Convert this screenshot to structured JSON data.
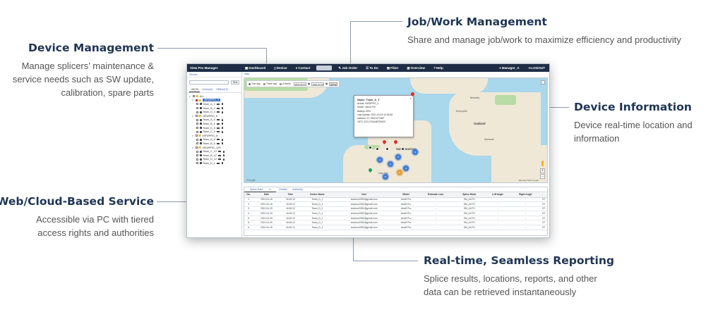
{
  "callouts": {
    "device_management": {
      "title": "Device Management",
      "text": "Manage splicers’ maintenance & service needs such as SW update, calibration, spare parts"
    },
    "job_management": {
      "title": "Job/Work Management",
      "text": "Share and manage job/work to maximize efficiency and productivity"
    },
    "device_information": {
      "title": "Device Information",
      "text": "Device real-time location and information"
    },
    "web_cloud": {
      "title": "Web/Cloud-Based Service",
      "text": "Accessible via PC with tiered access rights and authorities"
    },
    "reporting": {
      "title": "Real-time, Seamless Reporting",
      "text": "Splice results, locations, reports, and other data can be retrieved instantaneously"
    }
  },
  "app": {
    "brand": "View Pro Manager",
    "nav": [
      {
        "label": "Dashboard",
        "icon": "▦"
      },
      {
        "label": "Device",
        "icon": "▯"
      },
      {
        "label": "Contact",
        "icon": "●"
      },
      {
        "label": "",
        "icon": ""
      },
      {
        "label": "Job Order",
        "icon": "✎"
      },
      {
        "label": "To Do",
        "icon": "☰"
      },
      {
        "label": "Fiber",
        "icon": "▤"
      },
      {
        "label": "Overview",
        "icon": "▥"
      },
      {
        "label": "Help",
        "icon": "?"
      }
    ],
    "user": "Manager_A",
    "logout": "LOGOUT",
    "sidebar": {
      "heading": "Device",
      "find_label": "Find",
      "tabs": [
        "All(15)",
        "Online(0)",
        "Offline(15)"
      ],
      "tree": {
        "root": "ALL",
        "groups": [
          {
            "name": "VIEWPRO_3",
            "selected": true,
            "members": [
              "Team_A_3",
              "Team_B_3",
              "Team_D_3"
            ]
          },
          {
            "name": "VIEWPRO_5",
            "selected": false,
            "members": [
              "Team_A_5",
              "Team_B_5",
              "Team_D_5",
              "Team_C_5"
            ]
          },
          {
            "name": "VIEWPRO_8",
            "selected": false,
            "members": [
              "Team_A_8",
              "Team_B_8"
            ]
          },
          {
            "name": "VIEWPRO_12R",
            "selected": false,
            "members": [
              "Team_C_12",
              "Team_B_12",
              "Team_D_12",
              "Team_D_1"
            ]
          }
        ]
      }
    },
    "map": {
      "heading": "Map",
      "periods": [
        "One day",
        "Three day",
        "A Week"
      ],
      "date_from": "2021.03.21",
      "date_to": "2021.04.15",
      "query_label": "Query",
      "popup": {
        "name": "Name: Team_A_3",
        "lines": [
          "Actual: VIEWPRO_3",
          "Model: View3 Pro",
          "Battery: 69%",
          "Last Update: 2021-04-15 10:36:35",
          "address: 37.78427471567 1873,-122.4715448729509"
        ]
      },
      "places": [
        "San Francisco",
        "Oakland",
        "Alameda",
        "Sausalito",
        "Berkeley",
        "Daly City",
        "Emeryville"
      ],
      "google": "Google",
      "attribution": "Map data ©2021 Google"
    },
    "report": {
      "tabs": [
        "Splice Data",
        "Details",
        "Authority"
      ],
      "columns": [
        "No.",
        "Date",
        "Time",
        "Device Name",
        "User",
        "Model",
        "Estimate Loss",
        "Splice Mode",
        "Left Angle",
        "Right Angle",
        ""
      ],
      "rows": [
        [
          "1",
          "2021-04-16",
          "16:26:12",
          "Team_D_1",
          "kmutsor2000@gmail.com",
          "view5 Pro",
          "-",
          "SM_AUTO",
          "-",
          "-",
          "ST"
        ],
        [
          "2",
          "2021-04-15",
          "16:26:12",
          "Team_D_1",
          "kmutsor2000@gmail.com",
          "view5 Pro",
          "-",
          "SM_AUTO",
          "-",
          "-",
          "ST"
        ],
        [
          "3",
          "2021-04-15",
          "16:26:12",
          "Team_D_1",
          "kmutsor2000@gmail.com",
          "view5 Pro",
          "-",
          "SM_AUTO",
          "-",
          "-",
          "ST"
        ],
        [
          "4",
          "2021-04-15",
          "16:26:12",
          "Team_D_1",
          "kmutsor2000@gmail.com",
          "view5 Pro",
          "-",
          "SM_AUTO",
          "-",
          "-",
          "ST"
        ],
        [
          "5",
          "2021-04-15",
          "16:26:12",
          "Team_D_1",
          "kmutsor2000@gmail.com",
          "view5 Pro",
          "-",
          "SM_AUTO",
          "-",
          "-",
          "ST"
        ],
        [
          "6",
          "2021-04-15",
          "16:26:12",
          "Team_D_1",
          "kmutsor2000@gmail.com",
          "view5 Pro",
          "-",
          "SM_AUTO",
          "-",
          "-",
          "ST"
        ],
        [
          "6",
          "2021-04-15",
          "16:26:12",
          "Team_D_1",
          "kmutsor2000@gmail.com",
          "view5 Pro",
          "-",
          "SM_AUTO",
          "-",
          "-",
          "ST"
        ]
      ]
    }
  }
}
